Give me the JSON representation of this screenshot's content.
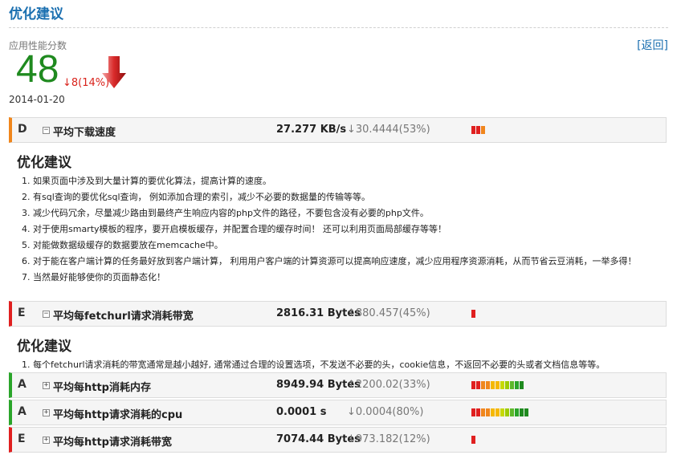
{
  "page": {
    "title": "优化建议",
    "back_label": "[返回]"
  },
  "score": {
    "label": "应用性能分数",
    "value": "48",
    "delta": "↓8(14%)",
    "date": "2014-01-20",
    "trend": "down"
  },
  "colors": {
    "accent": "#1a6fb0",
    "score": "#1f8a1f",
    "red": "#e02020",
    "orange": "#f0861c",
    "green": "#2aa52a"
  },
  "metrics": [
    {
      "grade": "D",
      "toggle": "−",
      "name": "平均下载速度",
      "value": "27.277 KB/s",
      "change": "↓30.4444(53%)",
      "border_color": "#f0861c",
      "bars": [
        "#e02020",
        "#e02020",
        "#f0861c"
      ]
    },
    {
      "grade": "E",
      "toggle": "−",
      "name": "平均每fetchurl请求消耗带宽",
      "value": "2816.31 Bytes",
      "change": "↑880.457(45%)",
      "border_color": "#e02020",
      "bars": [
        "#e02020"
      ]
    },
    {
      "grade": "A",
      "toggle": "+",
      "name": "平均每http消耗内存",
      "value": "8949.94 Bytes",
      "change": "↑2200.02(33%)",
      "border_color": "#2aa52a",
      "bars": [
        "#e02020",
        "#e02020",
        "#f0861c",
        "#f0861c",
        "#f5b800",
        "#f5b800",
        "#c7d900",
        "#9dcc00",
        "#5cb82a",
        "#2aa52a",
        "#1f8a1f"
      ]
    },
    {
      "grade": "A",
      "toggle": "+",
      "name": "平均每http请求消耗的cpu",
      "value": "0.0001 s",
      "change": "↓0.0004(80%)",
      "border_color": "#2aa52a",
      "bars": [
        "#e02020",
        "#e02020",
        "#f0861c",
        "#f0861c",
        "#f5b800",
        "#f5b800",
        "#c7d900",
        "#9dcc00",
        "#5cb82a",
        "#2aa52a",
        "#1f8a1f",
        "#1f8a1f"
      ]
    },
    {
      "grade": "E",
      "toggle": "+",
      "name": "平均每http请求消耗带宽",
      "value": "7074.44 Bytes",
      "change": "↓973.182(12%)",
      "border_color": "#e02020",
      "bars": [
        "#e02020"
      ]
    }
  ],
  "advice": [
    {
      "title": "优化建议",
      "items": [
        "如果页面中涉及到大量计算的要优化算法，提高计算的速度。",
        "有sql查询的要优化sql查询， 例如添加合理的索引，减少不必要的数据量的传输等等。",
        "减少代码冗余，尽量减少路由到最终产生响应内容的php文件的路径，不要包含没有必要的php文件。",
        "对于使用smarty模板的程序，要开启模板缓存，并配置合理的缓存时间！ 还可以利用页面局部缓存等等！",
        "对能做数据级缓存的数据要放在memcache中。",
        "对于能在客户端计算的任务最好放到客户端计算， 利用用户客户端的计算资源可以提高响应速度，减少应用程序资源消耗，从而节省云豆消耗，一举多得！",
        "当然最好能够使你的页面静态化！"
      ]
    },
    {
      "title": "优化建议",
      "items": [
        "每个fetchurl请求消耗的带宽通常是越小越好, 通常通过合理的设置选项，不发送不必要的头，cookie信息，不返回不必要的头或者文档信息等等。"
      ]
    }
  ]
}
